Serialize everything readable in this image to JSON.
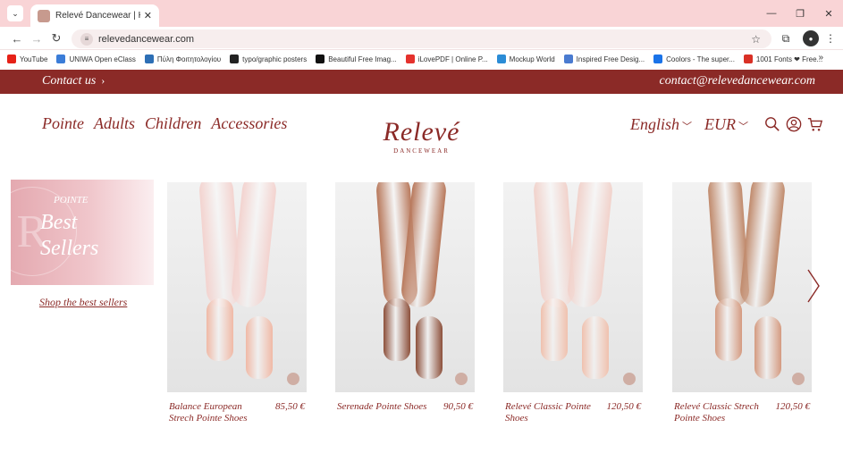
{
  "browser": {
    "tab_title": "Relevé Dancewear | Home",
    "url": "relevedancewear.com",
    "bookmarks": [
      {
        "label": "YouTube",
        "color": "#e62117"
      },
      {
        "label": "UNIWA Open eClass",
        "color": "#3b7dd8"
      },
      {
        "label": "Πύλη Φοιτητολογίου",
        "color": "#2d6fb5"
      },
      {
        "label": "typo/graphic posters",
        "color": "#222222"
      },
      {
        "label": "Beautiful Free Imag...",
        "color": "#111111"
      },
      {
        "label": "iLovePDF | Online P...",
        "color": "#e5322d"
      },
      {
        "label": "Mockup World",
        "color": "#2b8cd6"
      },
      {
        "label": "Inspired Free Desig...",
        "color": "#4a7bd0"
      },
      {
        "label": "Coolors - The super...",
        "color": "#1a73e8"
      },
      {
        "label": "1001 Fonts ❤ Free...",
        "color": "#d93025"
      }
    ]
  },
  "site": {
    "topbar": {
      "contact": "Contact us",
      "email": "contact@relevedancewear.com"
    },
    "nav": [
      "Pointe",
      "Adults",
      "Children",
      "Accessories"
    ],
    "logo": {
      "name": "Relevé",
      "tagline": "DANCEWEAR"
    },
    "language": "English",
    "currency": "EUR",
    "accent": "#8b2a27"
  },
  "promo": {
    "kicker": "POINTE",
    "line1": "Best",
    "line2": "Sellers",
    "link": "Shop the best sellers"
  },
  "products": [
    {
      "name": "Balance European Strech Pointe Shoes",
      "price": "85,50 €",
      "skin": "#f3d3cf",
      "shoe": "#f0b9a6"
    },
    {
      "name": "Serenade Pointe Shoes",
      "price": "90,50 €",
      "skin": "#b8785b",
      "shoe": "#8c4f3a"
    },
    {
      "name": "Relevé Classic Pointe Shoes",
      "price": "120,50 €",
      "skin": "#f1d2cb",
      "shoe": "#f0c1ae"
    },
    {
      "name": "Relevé Classic Strech Pointe Shoes",
      "price": "120,50 €",
      "skin": "#c08a6c",
      "shoe": "#d49a80"
    }
  ]
}
